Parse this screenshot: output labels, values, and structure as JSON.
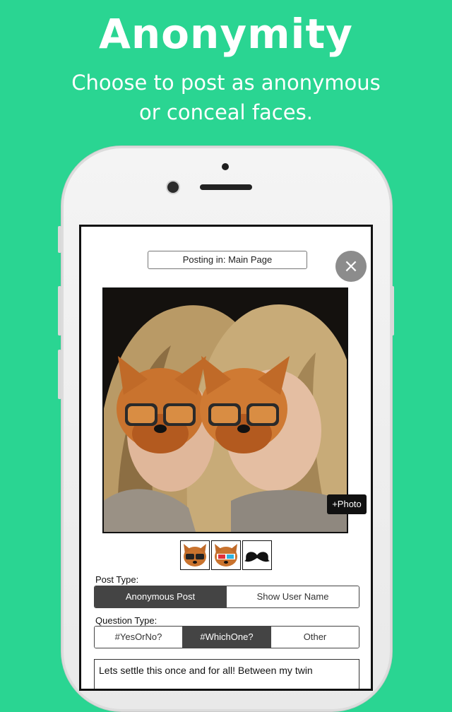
{
  "promo": {
    "headline": "Anonymity",
    "subline_1": "Choose to post as anonymous",
    "subline_2": "or conceal faces."
  },
  "header": {
    "posting_in": "Posting in: Main Page",
    "close_glyph": "×"
  },
  "photo": {
    "add_photo_label": "+Photo"
  },
  "stickers": [
    "yorkie-sunglasses-icon",
    "yorkie-3d-glasses-icon",
    "mustache-icon"
  ],
  "post_type": {
    "label": "Post Type:",
    "options": [
      "Anonymous Post",
      "Show User Name"
    ],
    "selected": "Anonymous Post"
  },
  "question_type": {
    "label": "Question Type:",
    "options": [
      "#YesOrNo?",
      "#WhichOne?",
      "Other"
    ],
    "selected": "#WhichOne?"
  },
  "message": {
    "text": "Lets settle this once and for all! Between my twin"
  },
  "colors": {
    "background": "#2ad592",
    "selected_segment": "#444444"
  }
}
